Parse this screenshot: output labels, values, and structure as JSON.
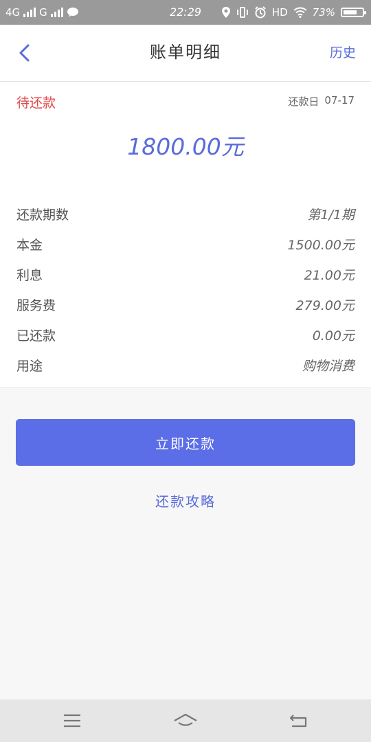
{
  "status_bar": {
    "network1": "4G",
    "network2": "G",
    "time": "22:29",
    "hd": "HD",
    "battery_pct": "73%",
    "battery_level": 0.73
  },
  "header": {
    "title": "账单明细",
    "history": "历史"
  },
  "bill": {
    "status": "待还款",
    "due_label": "还款日",
    "due_date": "07-17",
    "amount": "1800.00元",
    "rows": [
      {
        "label": "还款期数",
        "value": "第1/1期"
      },
      {
        "label": "本金",
        "value": "1500.00元"
      },
      {
        "label": "利息",
        "value": "21.00元"
      },
      {
        "label": "服务费",
        "value": "279.00元"
      },
      {
        "label": "已还款",
        "value": "0.00元"
      },
      {
        "label": "用途",
        "value": "购物消费"
      }
    ]
  },
  "actions": {
    "pay_now": "立即还款",
    "guide": "还款攻略"
  },
  "colors": {
    "accent": "#5b6ee8",
    "status_red": "#e04848",
    "status_bar_bg": "#9a9a9a"
  },
  "icons": {
    "back": "chevron-left-icon",
    "menu": "menu-icon",
    "home": "home-icon",
    "return": "return-icon"
  }
}
